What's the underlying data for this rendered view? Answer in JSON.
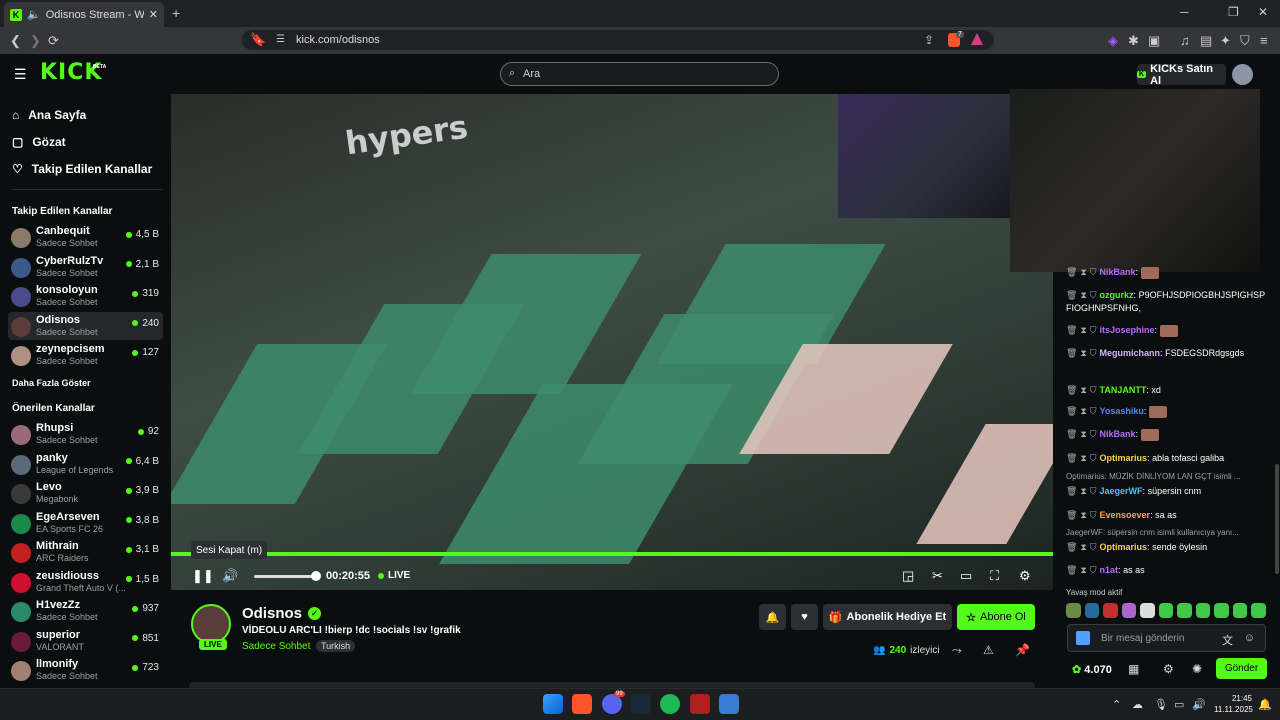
{
  "browser": {
    "tab_title": "Odisnos Stream - Watch Live",
    "url": "kick.com/odisnos",
    "shield_badge": "7"
  },
  "header": {
    "logo": "KICK",
    "beta": "BETA",
    "search_placeholder": "Ara",
    "buy_kicks": "KICKs Satın Al"
  },
  "sidebar": {
    "nav": [
      {
        "label": "Ana Sayfa",
        "icon": "home-icon"
      },
      {
        "label": "Gözat",
        "icon": "compass-icon"
      },
      {
        "label": "Takip Edilen Kanallar",
        "icon": "heart-icon"
      }
    ],
    "followed_title": "Takip Edilen Kanallar",
    "followed": [
      {
        "name": "Canbequit",
        "sub": "Sadece Sohbet",
        "viewers": "4,5 B",
        "color": "#8a7a6a"
      },
      {
        "name": "CyberRulzTv",
        "sub": "Sadece Sohbet",
        "viewers": "2,1 B",
        "color": "#3a5a8a"
      },
      {
        "name": "konsoloyun",
        "sub": "Sadece Sohbet",
        "viewers": "319",
        "color": "#4a4a8a"
      },
      {
        "name": "Odisnos",
        "sub": "Sadece Sohbet",
        "viewers": "240",
        "color": "#5a3c3a"
      },
      {
        "name": "zeynepcisem",
        "sub": "Sadece Sohbet",
        "viewers": "127",
        "color": "#b09080"
      }
    ],
    "show_more": "Daha Fazla Göster",
    "recommended_title": "Önerilen Kanallar",
    "recommended": [
      {
        "name": "Rhupsi",
        "sub": "Sadece Sohbet",
        "viewers": "92",
        "color": "#9a6a7a"
      },
      {
        "name": "panky",
        "sub": "League of Legends",
        "viewers": "6,4 B",
        "color": "#5a6a7a"
      },
      {
        "name": "Levo",
        "sub": "Megabonk",
        "viewers": "3,9 B",
        "color": "#3a3a3a"
      },
      {
        "name": "EgeArseven",
        "sub": "EA Sports FC 26",
        "viewers": "3,8 B",
        "color": "#1a8a4a"
      },
      {
        "name": "Mithrain",
        "sub": "ARC Raiders",
        "viewers": "3,1 B",
        "color": "#c02020"
      },
      {
        "name": "zeusidiouss",
        "sub": "Grand Theft Auto V (...",
        "viewers": "1,5 B",
        "color": "#d01030"
      },
      {
        "name": "H1vezZz",
        "sub": "Sadece Sohbet",
        "viewers": "937",
        "color": "#2a8a6a"
      },
      {
        "name": "superior",
        "sub": "VALORANT",
        "viewers": "851",
        "color": "#6a1a3a"
      },
      {
        "name": "llmonify",
        "sub": "Sadece Sohbet",
        "viewers": "723",
        "color": "#a08070"
      }
    ]
  },
  "video": {
    "wall_text": "hypers",
    "tooltip": "Sesi Kapat (m)",
    "time": "00:20:55",
    "live": "LIVE"
  },
  "stream": {
    "name": "Odisnos",
    "live_tag": "LIVE",
    "title": "VİDEOLU ARC'LI !bierp !dc !socials !sv !grafik",
    "category": "Sadece Sohbet",
    "language": "Turkish",
    "gift_sub": "Abonelik Hediye Et",
    "subscribe": "Abone Ol",
    "viewers": "240",
    "viewers_label": "izleyici"
  },
  "chat": {
    "messages": [
      {
        "user": "NikBank",
        "text": "",
        "color": "#b86bff"
      },
      {
        "user": "ozgurkz",
        "text": "P9OFHJSDPIOGBHJSPIGHSPFIOGHNPSFNHG,",
        "color": "#53fc18"
      },
      {
        "user": "itsJosephine",
        "text": "",
        "color": "#b86bff"
      },
      {
        "user": "Megumichann",
        "text": "FSDEGSDRdgsgds",
        "color": "#d6b3ff"
      },
      {
        "user": "TANJANTT",
        "text": "xd",
        "color": "#53fc18"
      },
      {
        "user": "Yosashiku",
        "text": "",
        "color": "#4d8aff"
      },
      {
        "user": "NikBank",
        "text": "",
        "color": "#b86bff"
      },
      {
        "user": "Optimarius",
        "text": "abla tofasci galiba",
        "color": "#f5d547"
      },
      {
        "user": "JaegerWF",
        "text": "süpersin cnm",
        "color": "#4dc3ff"
      },
      {
        "user": "Evensoever",
        "text": "sa as",
        "color": "#ffa24d"
      },
      {
        "user": "Optimarius",
        "text": "sende öylesin",
        "color": "#f5d547"
      },
      {
        "user": "n1at",
        "text": "as as",
        "color": "#b86bff"
      }
    ],
    "reply1": "Optimarius: MÜZİK DİNLİYOM LAN GÇT isimli ...",
    "reply2": "JaegerWF: süpersin cnm isimli kullanıcıya yanı...",
    "slow_mode": "Yavaş mod aktif",
    "input_placeholder": "Bir mesaj gönderin",
    "points": "4.070",
    "send": "Gönder"
  },
  "taskbar": {
    "time": "21:45",
    "date": "11.11.2025",
    "discord_badge": "99"
  }
}
